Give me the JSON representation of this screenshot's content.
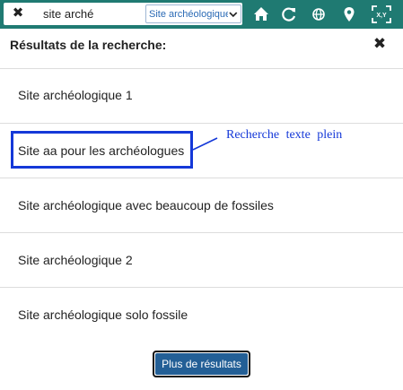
{
  "toolbar": {
    "search_value": "site arché",
    "clear_icon": "×-icon",
    "search_type_selected": "Site archéologique",
    "icons": [
      "home-icon",
      "refresh-icon",
      "globe-icon",
      "map-pin-icon",
      "xy-coordinates-icon"
    ],
    "xy_label": "X,Y",
    "background_color": "#1f7a72"
  },
  "panel": {
    "title": "Résultats de la recherche:",
    "close_icon": "close-icon"
  },
  "results": [
    {
      "label": "Site archéologique 1"
    },
    {
      "label": "Site aa pour les archéologues"
    },
    {
      "label": "Site archéologique avec beaucoup de fossiles"
    },
    {
      "label": "Site archéologique 2"
    },
    {
      "label": "Site archéologique solo fossile"
    }
  ],
  "annotation": {
    "text": "Recherche texte plein",
    "color": "#1438d8"
  },
  "more_button": {
    "label": "Plus de résultats",
    "color": "#235f96"
  }
}
